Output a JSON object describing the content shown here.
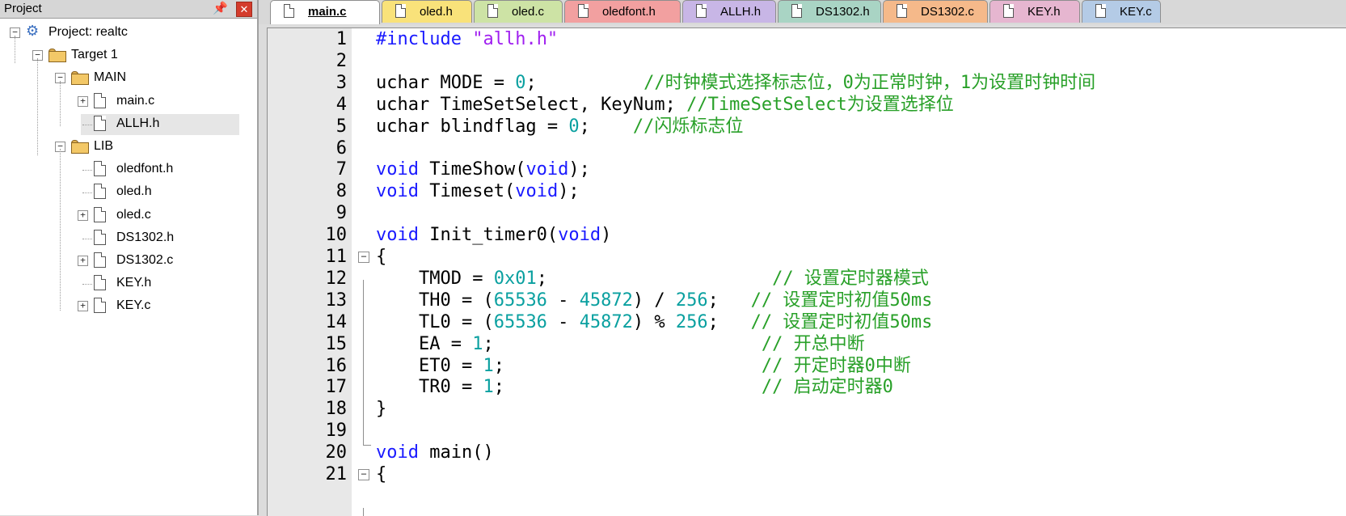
{
  "project_panel": {
    "title": "Project",
    "tree": [
      {
        "label": "Project: realtc",
        "type": "project",
        "expander": "⊟"
      },
      {
        "label": "Target 1",
        "type": "target",
        "expander": "⊟"
      },
      {
        "label": "MAIN",
        "type": "folder",
        "expander": "⊟"
      },
      {
        "label": "main.c",
        "type": "file",
        "expander": "⊞"
      },
      {
        "label": "ALLH.h",
        "type": "file",
        "expander": ""
      },
      {
        "label": "LIB",
        "type": "folder",
        "expander": "⊟"
      },
      {
        "label": "oledfont.h",
        "type": "file",
        "expander": ""
      },
      {
        "label": "oled.h",
        "type": "file",
        "expander": ""
      },
      {
        "label": "oled.c",
        "type": "file",
        "expander": "⊞"
      },
      {
        "label": "DS1302.h",
        "type": "file",
        "expander": ""
      },
      {
        "label": "DS1302.c",
        "type": "file",
        "expander": "⊞"
      },
      {
        "label": "KEY.h",
        "type": "file",
        "expander": ""
      },
      {
        "label": "KEY.c",
        "type": "file",
        "expander": "⊞"
      }
    ]
  },
  "tabs": [
    {
      "label": "main.c",
      "color": "#ffffff",
      "active": true
    },
    {
      "label": "oled.h",
      "color": "#f9e27a",
      "active": false
    },
    {
      "label": "oled.c",
      "color": "#cde3a5",
      "active": false
    },
    {
      "label": "oledfont.h",
      "color": "#f2a0a0",
      "active": false
    },
    {
      "label": "ALLH.h",
      "color": "#c8b6e6",
      "active": false
    },
    {
      "label": "DS1302.h",
      "color": "#a9d4c4",
      "active": false
    },
    {
      "label": "DS1302.c",
      "color": "#f5b98a",
      "active": false
    },
    {
      "label": "KEY.h",
      "color": "#e6b6d0",
      "active": false
    },
    {
      "label": "KEY.c",
      "color": "#b4cbe6",
      "active": false
    }
  ],
  "editor": {
    "lines": [
      {
        "n": "1",
        "tokens": [
          {
            "t": "#include ",
            "c": "kw"
          },
          {
            "t": "\"allh.h\"",
            "c": "str"
          }
        ]
      },
      {
        "n": "2",
        "tokens": []
      },
      {
        "n": "3",
        "tokens": [
          {
            "t": "uchar MODE = ",
            "c": ""
          },
          {
            "t": "0",
            "c": "num"
          },
          {
            "t": ";          ",
            "c": ""
          },
          {
            "t": "//时钟模式选择标志位，0为正常时钟，1为设置时钟时间",
            "c": "cmt"
          }
        ]
      },
      {
        "n": "4",
        "tokens": [
          {
            "t": "uchar TimeSetSelect, KeyNum; ",
            "c": ""
          },
          {
            "t": "//TimeSetSelect为设置选择位",
            "c": "cmt"
          }
        ]
      },
      {
        "n": "5",
        "tokens": [
          {
            "t": "uchar blindflag = ",
            "c": ""
          },
          {
            "t": "0",
            "c": "num"
          },
          {
            "t": ";    ",
            "c": ""
          },
          {
            "t": "//闪烁标志位",
            "c": "cmt"
          }
        ]
      },
      {
        "n": "6",
        "tokens": []
      },
      {
        "n": "7",
        "tokens": [
          {
            "t": "void",
            "c": "kw"
          },
          {
            "t": " TimeShow(",
            "c": ""
          },
          {
            "t": "void",
            "c": "kw"
          },
          {
            "t": ");",
            "c": ""
          }
        ]
      },
      {
        "n": "8",
        "tokens": [
          {
            "t": "void",
            "c": "kw"
          },
          {
            "t": " Timeset(",
            "c": ""
          },
          {
            "t": "void",
            "c": "kw"
          },
          {
            "t": ");",
            "c": ""
          }
        ]
      },
      {
        "n": "9",
        "tokens": []
      },
      {
        "n": "10",
        "tokens": [
          {
            "t": "void",
            "c": "kw"
          },
          {
            "t": " Init_timer0(",
            "c": ""
          },
          {
            "t": "void",
            "c": "kw"
          },
          {
            "t": ")",
            "c": ""
          }
        ]
      },
      {
        "n": "11",
        "tokens": [
          {
            "t": "{",
            "c": ""
          }
        ],
        "fold": "⊟"
      },
      {
        "n": "12",
        "tokens": [
          {
            "t": "    TMOD = ",
            "c": ""
          },
          {
            "t": "0x01",
            "c": "num"
          },
          {
            "t": ";                     ",
            "c": ""
          },
          {
            "t": "// 设置定时器模式",
            "c": "cmt"
          }
        ]
      },
      {
        "n": "13",
        "tokens": [
          {
            "t": "    TH0 = (",
            "c": ""
          },
          {
            "t": "65536",
            "c": "num"
          },
          {
            "t": " - ",
            "c": ""
          },
          {
            "t": "45872",
            "c": "num"
          },
          {
            "t": ") / ",
            "c": ""
          },
          {
            "t": "256",
            "c": "num"
          },
          {
            "t": ";   ",
            "c": ""
          },
          {
            "t": "// 设置定时初值50ms",
            "c": "cmt"
          }
        ]
      },
      {
        "n": "14",
        "tokens": [
          {
            "t": "    TL0 = (",
            "c": ""
          },
          {
            "t": "65536",
            "c": "num"
          },
          {
            "t": " - ",
            "c": ""
          },
          {
            "t": "45872",
            "c": "num"
          },
          {
            "t": ") % ",
            "c": ""
          },
          {
            "t": "256",
            "c": "num"
          },
          {
            "t": ";   ",
            "c": ""
          },
          {
            "t": "// 设置定时初值50ms",
            "c": "cmt"
          }
        ]
      },
      {
        "n": "15",
        "tokens": [
          {
            "t": "    EA = ",
            "c": ""
          },
          {
            "t": "1",
            "c": "num"
          },
          {
            "t": ";                         ",
            "c": ""
          },
          {
            "t": "// 开总中断",
            "c": "cmt"
          }
        ]
      },
      {
        "n": "16",
        "tokens": [
          {
            "t": "    ET0 = ",
            "c": ""
          },
          {
            "t": "1",
            "c": "num"
          },
          {
            "t": ";                        ",
            "c": ""
          },
          {
            "t": "// 开定时器0中断",
            "c": "cmt"
          }
        ]
      },
      {
        "n": "17",
        "tokens": [
          {
            "t": "    TR0 = ",
            "c": ""
          },
          {
            "t": "1",
            "c": "num"
          },
          {
            "t": ";                        ",
            "c": ""
          },
          {
            "t": "// 启动定时器0",
            "c": "cmt"
          }
        ]
      },
      {
        "n": "18",
        "tokens": [
          {
            "t": "}",
            "c": ""
          }
        ]
      },
      {
        "n": "19",
        "tokens": []
      },
      {
        "n": "20",
        "tokens": [
          {
            "t": "void",
            "c": "kw"
          },
          {
            "t": " main()",
            "c": ""
          }
        ]
      },
      {
        "n": "21",
        "tokens": [
          {
            "t": "{",
            "c": ""
          }
        ],
        "fold": "⊟"
      }
    ]
  }
}
